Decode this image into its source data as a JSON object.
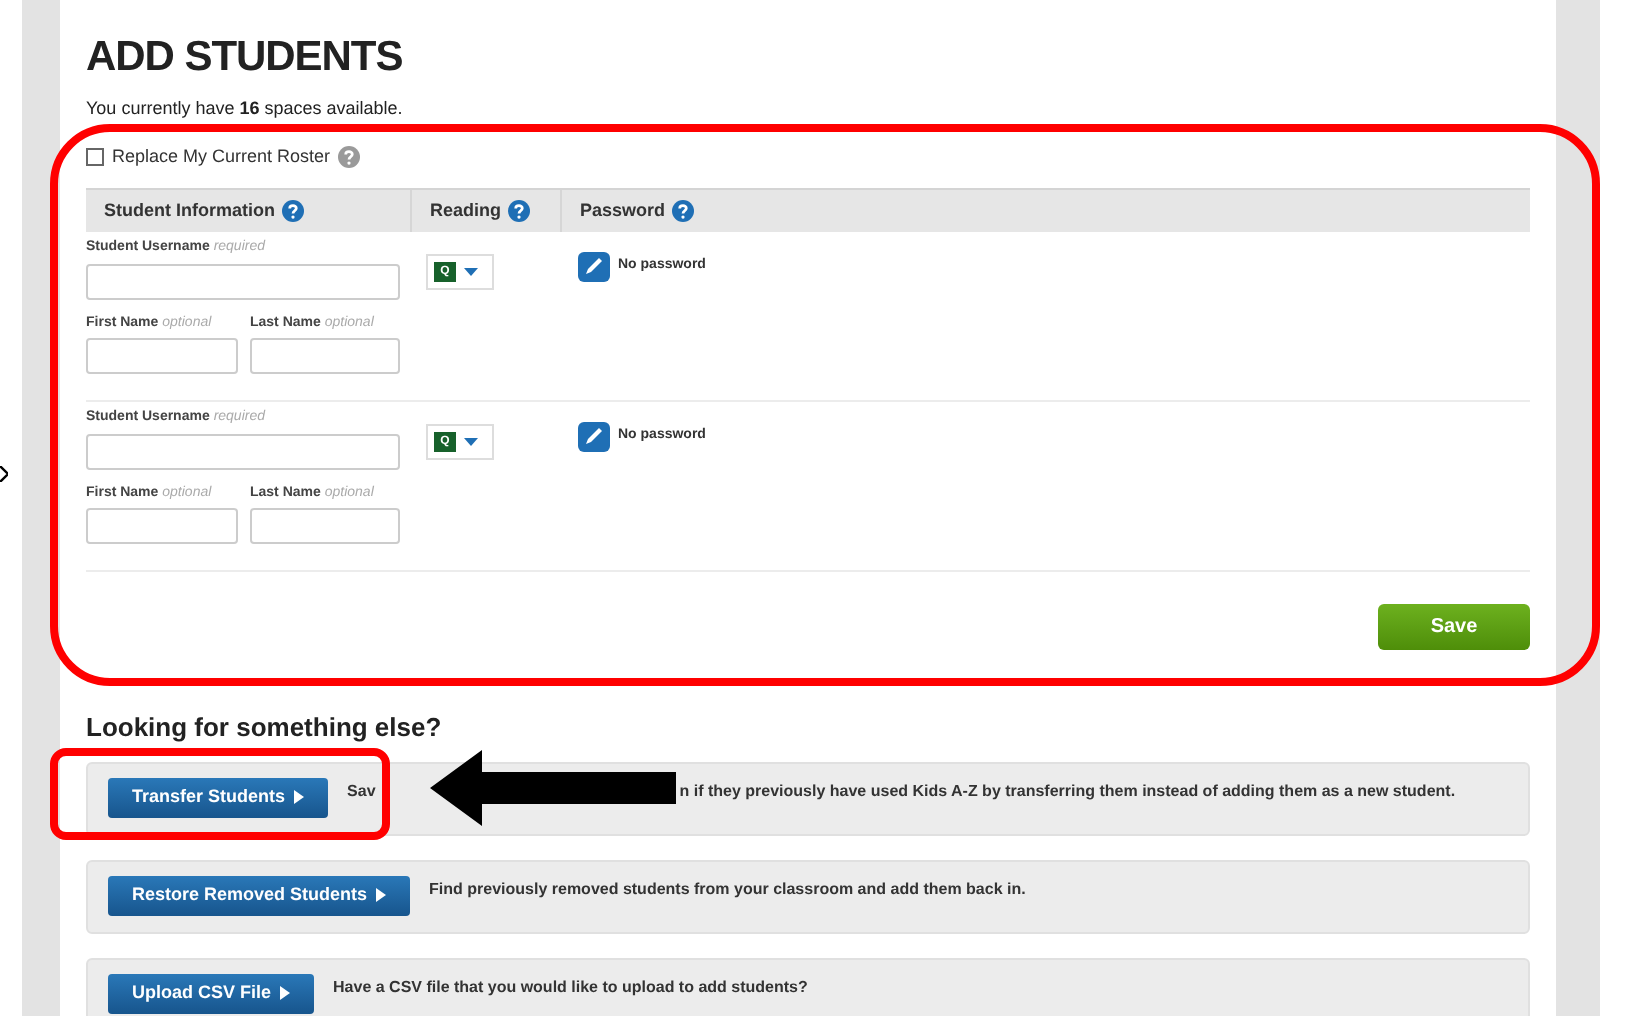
{
  "title": "ADD STUDENTS",
  "spaces_note": "You currently have **16** spaces available.",
  "replace_roster": {
    "label": "Replace My Current Roster",
    "checked": false
  },
  "table": {
    "columns": [
      "Student Information",
      "Reading",
      "Password"
    ],
    "rows": [
      {
        "username_label": "Student Username",
        "username_hint": "required",
        "first_label": "First Name",
        "first_hint": "optional",
        "last_label": "Last Name",
        "last_hint": "optional",
        "reading_level": "Q",
        "password": "No password"
      },
      {
        "username_label": "Student Username",
        "username_hint": "required",
        "first_label": "First Name",
        "first_hint": "optional",
        "last_label": "Last Name",
        "last_hint": "optional",
        "reading_level": "Q",
        "password": "No password"
      }
    ]
  },
  "save_button": "Save",
  "more": {
    "heading": "Looking for something else?",
    "options": [
      {
        "button": "Transfer Students",
        "description_parts": [
          "Sav",
          "n if they previously have used Kids A-Z by transferring them instead of adding them as a new student."
        ],
        "highlighted": true
      },
      {
        "button": "Restore Removed Students",
        "description_parts": [
          "Find previously removed students from your classroom and add them back in."
        ],
        "highlighted": false
      },
      {
        "button": "Upload CSV File",
        "description_parts": [
          "Have a CSV file that you would like to upload to add students?"
        ],
        "highlighted": false
      }
    ]
  }
}
